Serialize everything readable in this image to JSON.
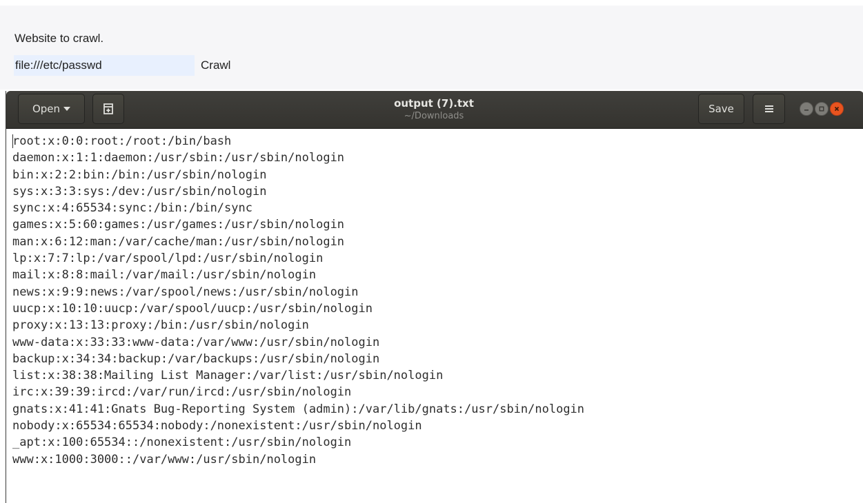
{
  "webpage": {
    "label": "Website to crawl.",
    "url_value": "file:///etc/passwd",
    "crawl_button": "Crawl"
  },
  "gedit": {
    "open_label": "Open",
    "title": "output (7).txt",
    "subtitle": "~/Downloads",
    "save_label": "Save",
    "icons": {
      "open_menu": "chevron-down-icon",
      "new_tab": "new-tab-icon",
      "hamburger": "hamburger-menu-icon",
      "minimize": "minimize-icon",
      "maximize": "maximize-icon",
      "close": "close-icon"
    },
    "colors": {
      "headerbar": "#3b3a36",
      "close_button": "#e9541f",
      "text": "#2e2e2e"
    },
    "lines": [
      "root:x:0:0:root:/root:/bin/bash",
      "daemon:x:1:1:daemon:/usr/sbin:/usr/sbin/nologin",
      "bin:x:2:2:bin:/bin:/usr/sbin/nologin",
      "sys:x:3:3:sys:/dev:/usr/sbin/nologin",
      "sync:x:4:65534:sync:/bin:/bin/sync",
      "games:x:5:60:games:/usr/games:/usr/sbin/nologin",
      "man:x:6:12:man:/var/cache/man:/usr/sbin/nologin",
      "lp:x:7:7:lp:/var/spool/lpd:/usr/sbin/nologin",
      "mail:x:8:8:mail:/var/mail:/usr/sbin/nologin",
      "news:x:9:9:news:/var/spool/news:/usr/sbin/nologin",
      "uucp:x:10:10:uucp:/var/spool/uucp:/usr/sbin/nologin",
      "proxy:x:13:13:proxy:/bin:/usr/sbin/nologin",
      "www-data:x:33:33:www-data:/var/www:/usr/sbin/nologin",
      "backup:x:34:34:backup:/var/backups:/usr/sbin/nologin",
      "list:x:38:38:Mailing List Manager:/var/list:/usr/sbin/nologin",
      "irc:x:39:39:ircd:/var/run/ircd:/usr/sbin/nologin",
      "gnats:x:41:41:Gnats Bug-Reporting System (admin):/var/lib/gnats:/usr/sbin/nologin",
      "nobody:x:65534:65534:nobody:/nonexistent:/usr/sbin/nologin",
      "_apt:x:100:65534::/nonexistent:/usr/sbin/nologin",
      "www:x:1000:3000::/var/www:/usr/sbin/nologin"
    ]
  }
}
